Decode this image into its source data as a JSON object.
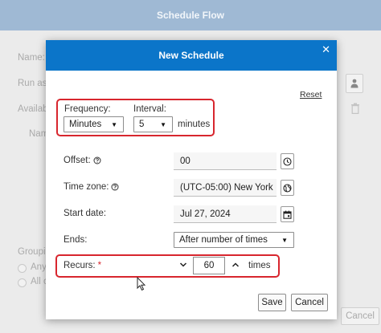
{
  "background_dialog": {
    "title": "Schedule Flow",
    "labels": {
      "name": "Name:",
      "run_as": "Run as:",
      "available": "Availab",
      "name_column": "Nam",
      "grouping": "Groupi",
      "any": "Any",
      "all": "All c"
    },
    "cancel_label": "Cancel"
  },
  "modal": {
    "title": "New Schedule",
    "close_glyph": "✕",
    "reset_label": "Reset",
    "frequency": {
      "label": "Frequency:",
      "value": "Minutes"
    },
    "interval": {
      "label": "Interval:",
      "value": "5",
      "unit": "minutes"
    },
    "offset": {
      "label": "Offset:",
      "value": "00"
    },
    "time_zone": {
      "label": "Time zone:",
      "value": "(UTC-05:00) New York"
    },
    "start_date": {
      "label": "Start date:",
      "value": "Jul 27, 2024"
    },
    "ends": {
      "label": "Ends:",
      "value": "After number of times"
    },
    "recurs": {
      "label": "Recurs:",
      "required_mark": "*",
      "value": "60",
      "unit": "times"
    },
    "save_label": "Save",
    "cancel_label": "Cancel"
  },
  "icons": {
    "help": "help-circle-icon",
    "clock": "clock-icon",
    "globe": "globe-icon",
    "calendar": "calendar-icon",
    "chevron_down": "chevron-down-icon",
    "chevron_up": "chevron-up-icon",
    "user": "user-icon",
    "trash": "trash-icon"
  },
  "colors": {
    "modal_header": "#0b75c9",
    "background_header": "#9fb9d4",
    "highlight": "#d8262e"
  }
}
